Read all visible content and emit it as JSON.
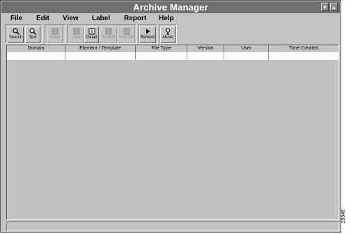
{
  "window": {
    "title": "Archive Manager",
    "minimize_glyph": "▾",
    "maximize_glyph": "▴"
  },
  "menu": [
    {
      "label": "File"
    },
    {
      "label": "Edit"
    },
    {
      "label": "View"
    },
    {
      "label": "Label"
    },
    {
      "label": "Report"
    },
    {
      "label": "Help"
    }
  ],
  "toolbar": {
    "buttons": [
      {
        "label": "Search",
        "icon": "search-icon",
        "enabled": true
      },
      {
        "label": "Text",
        "icon": "text-search-icon",
        "enabled": true
      },
      {
        "label": "Label",
        "icon": "label-icon",
        "enabled": false
      },
      {
        "label": "View",
        "icon": "view-icon",
        "enabled": false
      },
      {
        "label": "Detail",
        "icon": "detail-icon",
        "enabled": true
      },
      {
        "label": "TextDiff",
        "icon": "text-diff-icon",
        "enabled": false
      },
      {
        "label": "GUI Diff",
        "icon": "gui-diff-icon",
        "enabled": false
      },
      {
        "label": "Refresh",
        "icon": "refresh-icon",
        "enabled": true
      },
      {
        "label": "About",
        "icon": "about-icon",
        "enabled": true
      }
    ]
  },
  "table": {
    "columns": [
      "Domain",
      "Element / Template",
      "File Type",
      "Version",
      "User",
      "Time Created"
    ],
    "rows": [
      [
        "",
        "",
        "",
        "",
        "",
        ""
      ]
    ]
  },
  "figure_code": "29946",
  "colors": {
    "window_bg": "#c4c4c4",
    "titlebar": "#707070",
    "title_text": "#ffffff"
  }
}
